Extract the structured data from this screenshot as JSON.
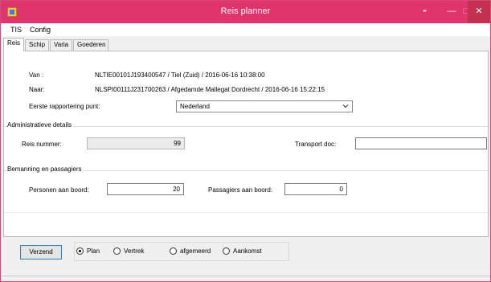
{
  "window": {
    "title": "Reis planner",
    "extra_label": "••"
  },
  "menu": {
    "items": [
      "TIS",
      "Config"
    ]
  },
  "tabs": [
    "Reis",
    "Schip",
    "Varia",
    "Goederen"
  ],
  "route": {
    "van_label": "Van :",
    "van_value": "NLTIE00101J193400547  /  Tiel (Zuid)  /  2016-06-16 10:38:00",
    "naar_label": "Naar:",
    "naar_value": "NLSPI00111J231700263  /  Afgedamde Mallegat Dordrecht  /  2016-06-16 15:22:15",
    "eerste_label": "Eerste rapportering punt:",
    "eerste_value": "Nederland"
  },
  "admin": {
    "title": "Administratieve details",
    "reis_label": "Reis nummer:",
    "reis_value": "99",
    "transport_label": "Transport doc:",
    "transport_value": ""
  },
  "crew": {
    "title": "Bemanning en passagiers",
    "personen_label": "Personen aan boord:",
    "personen_value": "20",
    "passagiers_label": "Passagiers aan boord:",
    "passagiers_value": "0"
  },
  "actions": {
    "send_label": "Verzend",
    "radios": [
      {
        "label": "Plan",
        "selected": true
      },
      {
        "label": "Vertrek",
        "selected": false
      },
      {
        "label": "afgemeerd",
        "selected": false
      },
      {
        "label": "Aankomst",
        "selected": false
      }
    ]
  },
  "colors": {
    "titlebar": "#e0356c",
    "close": "#c4304f"
  }
}
